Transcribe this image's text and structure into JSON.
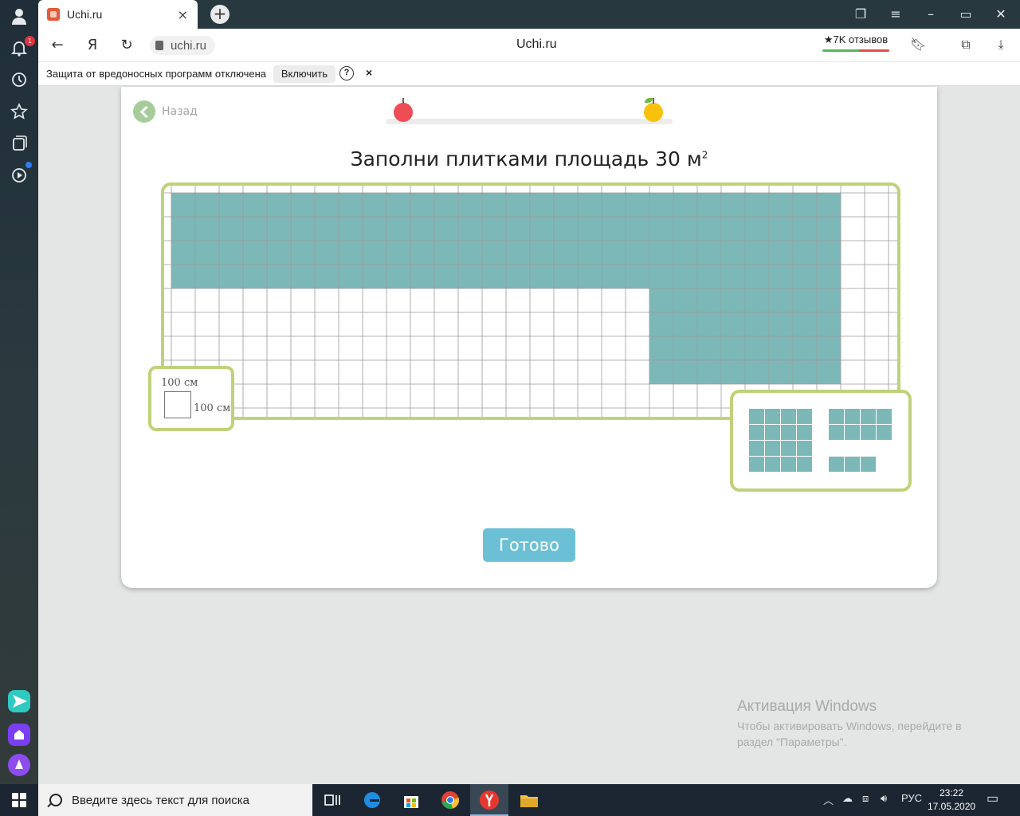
{
  "browser": {
    "tab_title": "Uchi.ru",
    "tab_close": "×",
    "new_tab": "+",
    "url": "uchi.ru",
    "page_title": "Uchi.ru",
    "reviews": "★7K отзывов",
    "yandex_letter": "Я",
    "notifications_badge": "1"
  },
  "infobar": {
    "message": "Защита от вредоносных программ отключена",
    "enable": "Включить",
    "help": "?",
    "close": "×"
  },
  "lesson": {
    "back": "Назад",
    "progress": 0.0,
    "title": "Заполни плитками площадь 30 м",
    "title_sup": "2",
    "scale_top": "100 см",
    "scale_side": "100 см",
    "done": "Готово",
    "grid": {
      "cols": 31,
      "rows": 10,
      "filled": [
        {
          "col": 0,
          "row": 0,
          "w": 28,
          "h": 4
        },
        {
          "col": 20,
          "row": 4,
          "w": 8,
          "h": 4
        }
      ],
      "fill_color": "#7db8b9",
      "line_color": "#9a9a9a"
    },
    "tiles": [
      {
        "cols": 4,
        "rows": 4
      },
      {
        "cols": 4,
        "rows": 2
      },
      {
        "cols": 3,
        "rows": 1
      }
    ],
    "accent": "#bfd27a",
    "button_color": "#6cc0d6"
  },
  "watermark": {
    "heading": "Активация Windows",
    "line1": "Чтобы активировать Windows, перейдите в",
    "line2": "раздел \"Параметры\"."
  },
  "taskbar": {
    "search_placeholder": "Введите здесь текст для поиска",
    "language": "РУС",
    "time": "23:22",
    "date": "17.05.2020"
  }
}
